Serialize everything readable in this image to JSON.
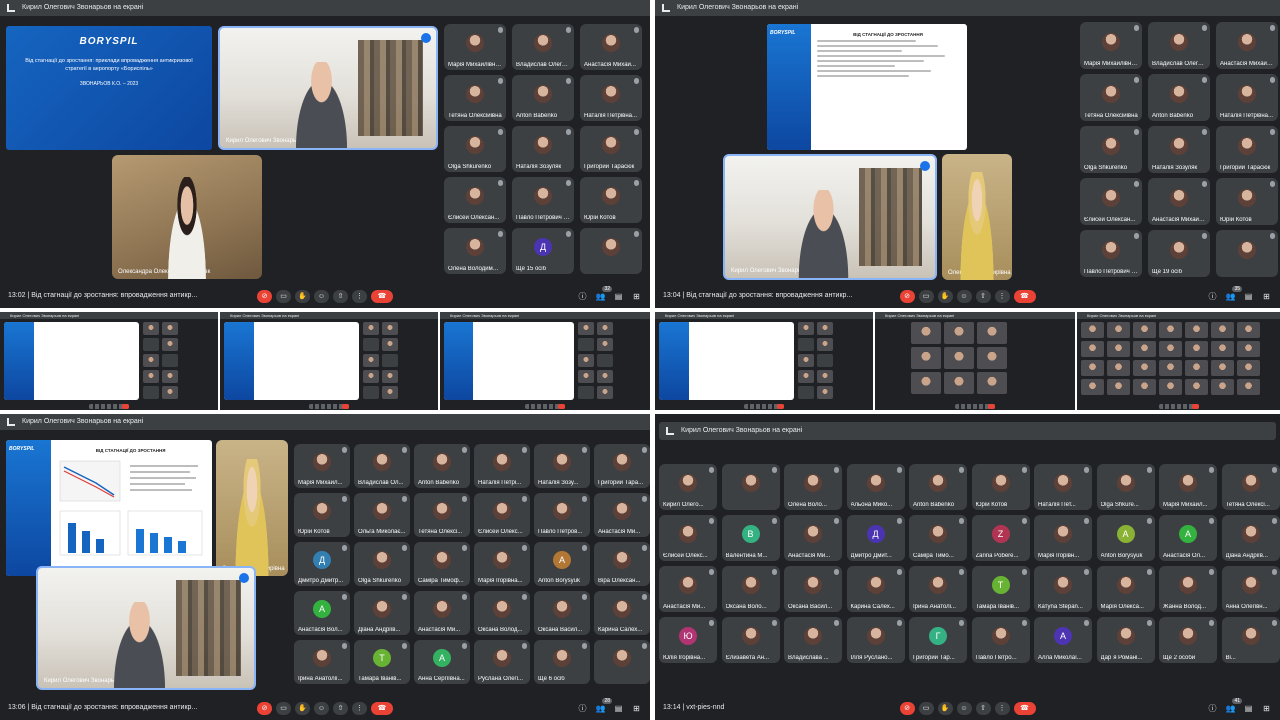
{
  "panels": {
    "tl": {
      "header": "Кирил Олегович Звонарьов на екрані",
      "time": "13:02",
      "meeting": "Від стагнації до зростання: впровадження антикр...",
      "people_count": "32",
      "slide": {
        "logo": "BORYSPIL",
        "title": "Від стагнації до зростання: приклади впровадження антикризової стратегії в аеропорту «Бориспіль»",
        "author": "ЗВОНАРЬОВ К.О. – 2023"
      },
      "presenter": "Кирил Олегович Звонарьов",
      "participant_cam": "Олександра Олександрівна Вовк",
      "tiles": [
        {
          "name": "Марія Михайлівна...",
          "av": ""
        },
        {
          "name": "Владислав Олегови...",
          "av": ""
        },
        {
          "name": "Анастасія Михай...",
          "av": ""
        },
        {
          "name": "Тетяна Олексійівна",
          "av": ""
        },
        {
          "name": "Anton Babenko",
          "av": ""
        },
        {
          "name": "Наталія Петрівна...",
          "av": ""
        },
        {
          "name": "Olga Shkurenko",
          "av": ""
        },
        {
          "name": "Наталія Зозуляк",
          "av": ""
        },
        {
          "name": "Григорий Тарасюк",
          "av": ""
        },
        {
          "name": "Єлисей Олексан...",
          "av": ""
        },
        {
          "name": "Павло Петрович В...",
          "av": ""
        },
        {
          "name": "Юрій Котов",
          "av": ""
        },
        {
          "name": "Олена Володимирівна",
          "av": ""
        },
        {
          "name": "Ще 15 осіб",
          "av": "Д"
        },
        {
          "name": "",
          "av": ""
        }
      ]
    },
    "tr": {
      "header": "Кирил Олегович Звонарьов на екрані",
      "time": "13:04",
      "meeting": "Від стагнації до зростання: впровадження антикр...",
      "people_count": "35",
      "slide": {
        "title": "ВІД СТАГНАЦІЇ ДО ЗРОСТАННЯ"
      },
      "presenter": "Кирил Олегович Звонарьов",
      "participant_cam": "Олена Володимирівна",
      "tiles": [
        {
          "name": "Марія Михайлівна...",
          "av": ""
        },
        {
          "name": "Владислав Олего...",
          "av": ""
        },
        {
          "name": "Анастасія Михайлівна",
          "av": ""
        },
        {
          "name": "Тетяна Олексійівна",
          "av": ""
        },
        {
          "name": "Anton Babenko",
          "av": ""
        },
        {
          "name": "Наталія Петрівна...",
          "av": ""
        },
        {
          "name": "Olga Shkurenko",
          "av": ""
        },
        {
          "name": "Наталія Зозуляк",
          "av": ""
        },
        {
          "name": "Григорий Тарасюк",
          "av": ""
        },
        {
          "name": "Єлисей Олексан...",
          "av": ""
        },
        {
          "name": "Анастасія Михайл...",
          "av": ""
        },
        {
          "name": "Юрій Котов",
          "av": ""
        },
        {
          "name": "Павло Петрович В...",
          "av": ""
        },
        {
          "name": "Ще 19 осіб",
          "av": ""
        },
        {
          "name": "",
          "av": ""
        }
      ]
    },
    "bl": {
      "header": "Кирил Олегович Звонарьов на екрані",
      "time": "13:06",
      "meeting": "Від стагнації до зростання: впровадження антикр...",
      "people_count": "28",
      "slide": {
        "logo": "BORYSPIL",
        "title": "ВІД СТАГНАЦІЇ ДО ЗРОСТАННЯ"
      },
      "presenter": "Кирил Олегович Звонарьов",
      "participant_cam": "Олена Володимирівна",
      "tiles": [
        {
          "name": "Марія Михайл...",
          "av": ""
        },
        {
          "name": "Владислав Ол...",
          "av": ""
        },
        {
          "name": "Anton Babenko",
          "av": ""
        },
        {
          "name": "Наталія Петрі...",
          "av": ""
        },
        {
          "name": "Наталія Зозу...",
          "av": ""
        },
        {
          "name": "Григорий Тара...",
          "av": ""
        },
        {
          "name": "Юрій Котов",
          "av": ""
        },
        {
          "name": "Ольга Миколає...",
          "av": ""
        },
        {
          "name": "Тетяна Олексі...",
          "av": ""
        },
        {
          "name": "Єлисей Олекс...",
          "av": ""
        },
        {
          "name": "Павло Петров...",
          "av": ""
        },
        {
          "name": "Анастасія Ми...",
          "av": ""
        },
        {
          "name": "Дмитро Дмитр...",
          "av": "Д"
        },
        {
          "name": "Olga Shkurenko",
          "av": ""
        },
        {
          "name": "Саміра Тимоф...",
          "av": ""
        },
        {
          "name": "Марія Ігорівна...",
          "av": ""
        },
        {
          "name": "Anton Borysyuk",
          "av": "A"
        },
        {
          "name": "Віра Олексан...",
          "av": ""
        },
        {
          "name": "Анастасія Вол...",
          "av": "A"
        },
        {
          "name": "Діана Андріїв...",
          "av": ""
        },
        {
          "name": "Анастасія Ми...",
          "av": ""
        },
        {
          "name": "Оксана Волод...",
          "av": ""
        },
        {
          "name": "Оксана Васил...",
          "av": ""
        },
        {
          "name": "Карина Салех...",
          "av": ""
        },
        {
          "name": "Ірина Анатолії...",
          "av": ""
        },
        {
          "name": "Тамара Іванів...",
          "av": "Т"
        },
        {
          "name": "Анна Сергіївна...",
          "av": "A"
        },
        {
          "name": "Руслана Олегі...",
          "av": ""
        },
        {
          "name": "Ще 6 осіб",
          "av": ""
        },
        {
          "name": "",
          "av": ""
        }
      ]
    },
    "br": {
      "header": "Кирил Олегович Звонарьов на екрані",
      "time": "13:14",
      "meeting": "vxt-pies-nnd",
      "people_count": "41",
      "tiles": [
        {
          "name": "Кирил Олего...",
          "av": ""
        },
        {
          "name": "",
          "av": ""
        },
        {
          "name": "Олена Воло...",
          "av": ""
        },
        {
          "name": "Альона Мико...",
          "av": ""
        },
        {
          "name": "Anton Babenko",
          "av": ""
        },
        {
          "name": "Юрій Котов",
          "av": ""
        },
        {
          "name": "Наталія Пет...",
          "av": ""
        },
        {
          "name": "Olga Shkure...",
          "av": ""
        },
        {
          "name": "Марія Михайл...",
          "av": ""
        },
        {
          "name": "Тетяна Олексі...",
          "av": ""
        },
        {
          "name": "Єлисей Олекс...",
          "av": ""
        },
        {
          "name": "Валентина М...",
          "av": "В"
        },
        {
          "name": "Анастасія Ми...",
          "av": ""
        },
        {
          "name": "Дмитро Дмит...",
          "av": "Д"
        },
        {
          "name": "Саміра Тимо...",
          "av": ""
        },
        {
          "name": "Zarina Pobere...",
          "av": "Z"
        },
        {
          "name": "Марія Ігорівн...",
          "av": ""
        },
        {
          "name": "Anton Borysyuk",
          "av": "A"
        },
        {
          "name": "Анастасія Ол...",
          "av": "A"
        },
        {
          "name": "Діана Андріїв...",
          "av": ""
        },
        {
          "name": "Анастасія Ми...",
          "av": ""
        },
        {
          "name": "Оксана Воло...",
          "av": ""
        },
        {
          "name": "Оксана Васил...",
          "av": ""
        },
        {
          "name": "Карина Салех...",
          "av": ""
        },
        {
          "name": "Ірина Анатолі...",
          "av": ""
        },
        {
          "name": "Тамара Іванів...",
          "av": "Т"
        },
        {
          "name": "Катуna Stepan...",
          "av": ""
        },
        {
          "name": "Марія Олекса...",
          "av": ""
        },
        {
          "name": "Жанна Волод...",
          "av": ""
        },
        {
          "name": "Анна Олегівн...",
          "av": ""
        },
        {
          "name": "Юлія Ігорівна...",
          "av": "Ю"
        },
        {
          "name": "Єлизавета Ан...",
          "av": ""
        },
        {
          "name": "Владислава ...",
          "av": ""
        },
        {
          "name": "Ілля Руслано...",
          "av": ""
        },
        {
          "name": "Григорий Тар...",
          "av": "Г"
        },
        {
          "name": "Павло Петро...",
          "av": ""
        },
        {
          "name": "Алла Миколаї...",
          "av": "A"
        },
        {
          "name": "Дар`я Романі...",
          "av": ""
        },
        {
          "name": "Ще 2 особи",
          "av": ""
        },
        {
          "name": "Ві...",
          "av": ""
        }
      ]
    }
  },
  "colors": {
    "background": "#202124",
    "tile": "#3c4043",
    "end_call": "#ea4335",
    "active_speaker": "#8ab4f8"
  },
  "icons": {
    "mic_off": "mic-off-icon",
    "camera": "camera-icon",
    "hand": "raise-hand-icon",
    "emoji": "emoji-icon",
    "present": "present-icon",
    "more": "more-icon",
    "end": "end-call-icon",
    "info": "info-icon",
    "people": "people-icon",
    "chat": "chat-icon",
    "activities": "activities-icon"
  }
}
